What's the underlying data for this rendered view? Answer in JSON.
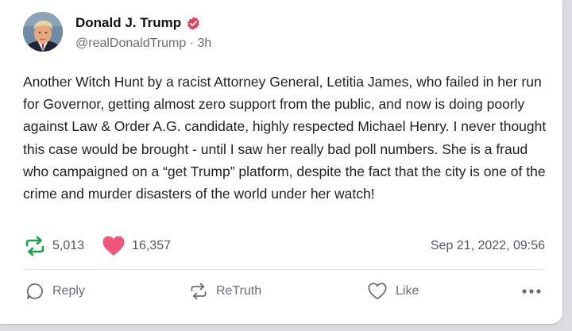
{
  "post": {
    "author_name": "Donald J. Trump",
    "handle": "@realDonaldTrump",
    "time_ago": "3h",
    "text": "Another Witch Hunt by a racist Attorney General, Letitia James, who failed in her run for Governor, getting almost zero support from the public, and now is doing poorly against Law & Order A.G. candidate, highly respected Michael Henry. I never thought this case would be brought - until I saw her really bad poll numbers. She is a fraud who campaigned on a “get Trump” platform, despite the fact that the city is one of the crime and murder disasters of the world under her watch!",
    "retruth_count": "5,013",
    "like_count": "16,357",
    "date": "Sep 21, 2022, 09:56"
  },
  "actions": {
    "reply_label": "Reply",
    "retruth_label": "ReTruth",
    "like_label": "Like"
  },
  "icons": {
    "verified": "verified-badge-icon",
    "retruth": "retruth-icon",
    "like": "heart-icon",
    "reply": "reply-bubble-icon",
    "more": "more-dots-icon"
  },
  "colors": {
    "verified_badge": "#e4415f",
    "retruth_active": "#17a34a",
    "like_active": "#f2557a",
    "muted_text": "#6b6b73"
  }
}
